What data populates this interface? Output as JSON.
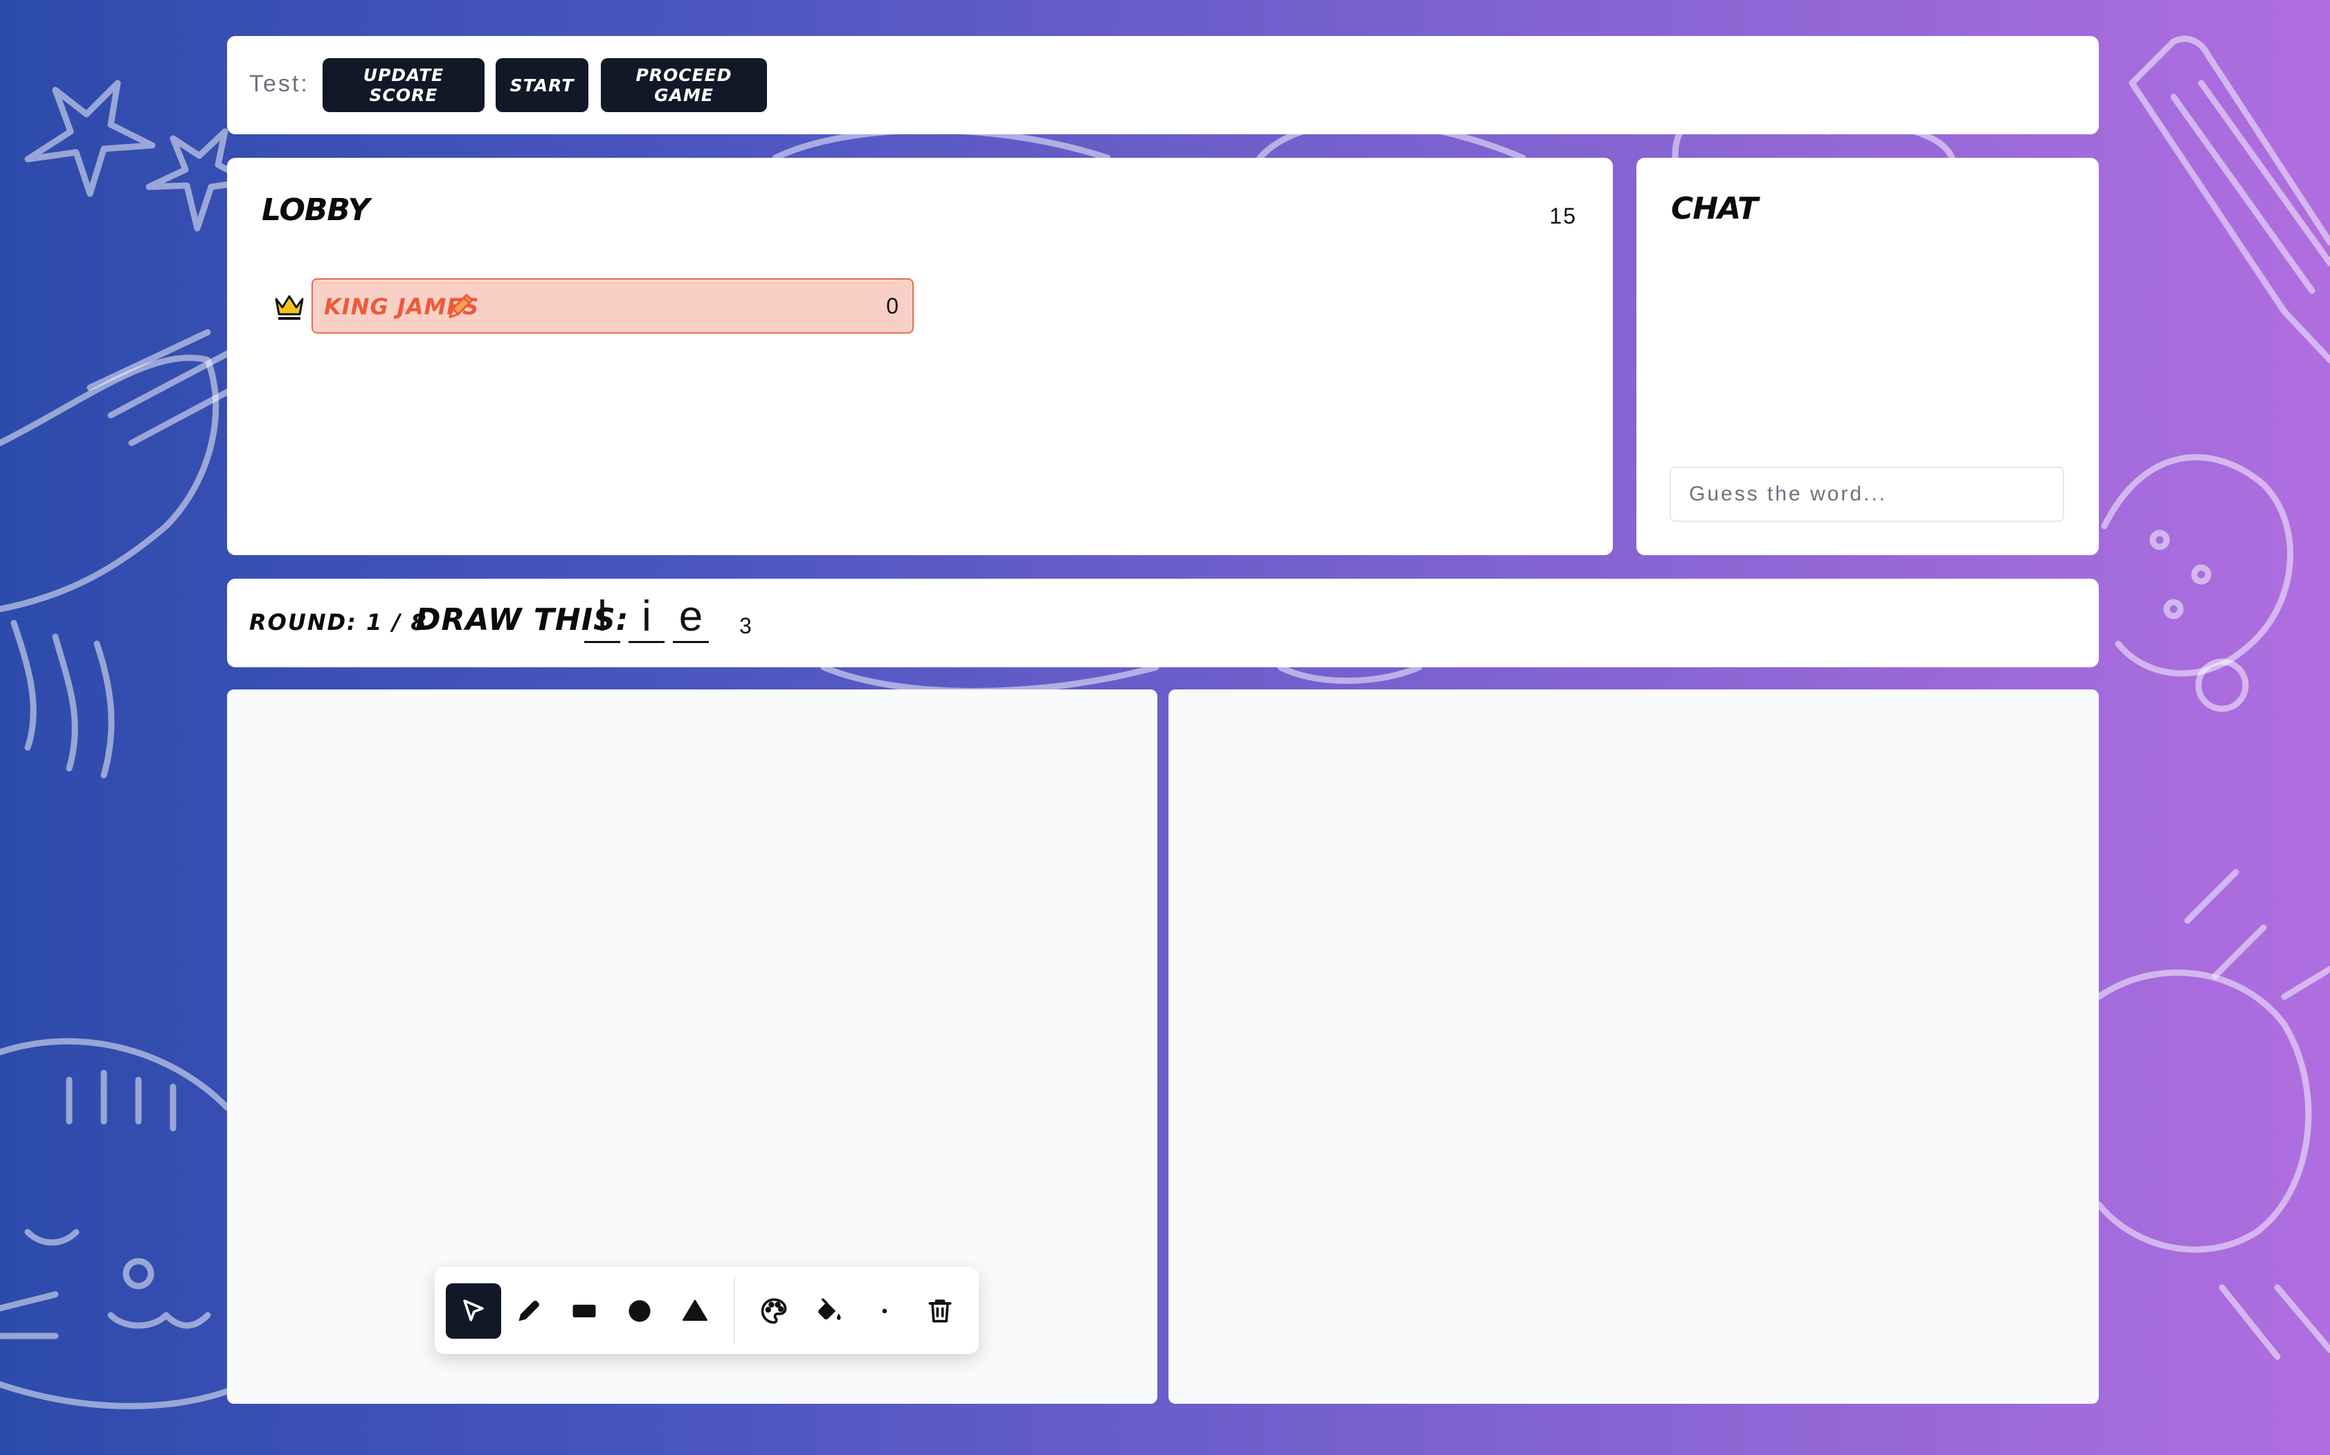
{
  "test_bar": {
    "label": "Test:",
    "buttons": [
      "UPDATE SCORE",
      "START",
      "PROCEED GAME"
    ]
  },
  "lobby": {
    "title": "LOBBY",
    "timer": "15",
    "players": [
      {
        "name": "KING JAMES",
        "score": "0",
        "is_host": true,
        "is_drawing": true
      }
    ]
  },
  "chat": {
    "title": "CHAT",
    "input_placeholder": "Guess the word...",
    "input_value": ""
  },
  "round": {
    "label": "ROUND: 1 / 8",
    "draw_label": "DRAW THIS:",
    "word_letters": [
      "l",
      "i",
      "e"
    ],
    "word_length": "3"
  },
  "toolbar": {
    "tools": [
      "select-icon",
      "pencil-icon",
      "rectangle-icon",
      "circle-icon",
      "triangle-icon",
      "palette-icon",
      "fill-bucket-icon",
      "brush-size-icon",
      "trash-icon"
    ],
    "active_tool": "select-icon"
  },
  "colors": {
    "accent_dark": "#111827",
    "player_highlight_bg": "#f8d0c6",
    "player_highlight_border": "#ee6b4e",
    "player_name": "#ec5a3c",
    "crown": "#f5c518",
    "canvas_bg": "#f8fafc",
    "gradient_left": "#2d4bab",
    "gradient_right": "#b06ee0"
  }
}
